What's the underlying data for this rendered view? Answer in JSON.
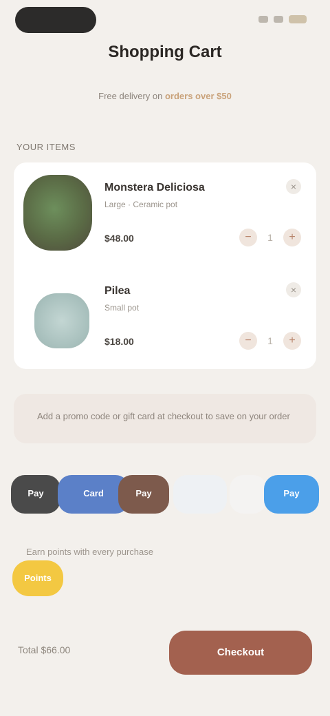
{
  "colors": {
    "background": "#f3f0ec",
    "accent": "#a3614f",
    "card": "#ffffff",
    "loyalty": "#f3c842",
    "pay_blue": "#4b9fe9"
  },
  "header": {
    "title": "Shopping Cart",
    "subtitle_prefix": "Free delivery on ",
    "subtitle_highlight": "orders over $50"
  },
  "cart": {
    "section_label": "YOUR ITEMS",
    "items": [
      {
        "name": "Monstera Deliciosa",
        "desc": "Large · Ceramic pot",
        "price": "$48.00",
        "qty": "1",
        "thumb_icon": "plant-thumb"
      },
      {
        "name": "Pilea",
        "desc": "Small pot",
        "price": "$18.00",
        "qty": "1",
        "thumb_icon": "plant-thumb"
      }
    ]
  },
  "promo": {
    "text": "Add a promo code or gift card at checkout to save on your order"
  },
  "payments": [
    {
      "label": "Pay",
      "icon": "apple-pay-icon"
    },
    {
      "label": "Card",
      "icon": "card-icon"
    },
    {
      "label": "Pay",
      "icon": "wallet-icon"
    },
    {
      "label": "",
      "icon": "blank-method-icon"
    },
    {
      "label": "",
      "icon": "blank-method-icon"
    },
    {
      "label": "Pay",
      "icon": "paypal-icon"
    }
  ],
  "loyalty": {
    "text": "Earn points with every purchase",
    "badge": "Points"
  },
  "footer": {
    "total_label": "Total $66.00",
    "checkout_label": "Checkout"
  }
}
